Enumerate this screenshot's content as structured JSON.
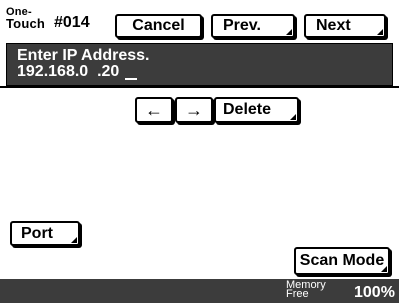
{
  "header": {
    "one_touch_line1": "One-",
    "one_touch_line2": "Touch",
    "entry_number": "#014",
    "cancel_label": "Cancel",
    "prev_label": "Prev.",
    "next_label": "Next"
  },
  "display": {
    "prompt": "Enter IP Address.",
    "ip_value": "192.168.0  .20"
  },
  "edit_buttons": {
    "left_arrow": "←",
    "right_arrow": "→",
    "delete_label": "Delete"
  },
  "port_label": "Port",
  "scan_mode_label": "Scan Mode",
  "status": {
    "memory_line1": "Memory",
    "memory_line2": "Free",
    "memory_value": "100%"
  },
  "colors": {
    "panel_background": "#3c3c3c",
    "text_light": "#ffffff"
  },
  "icons": [
    "left-arrow-icon",
    "right-arrow-icon"
  ]
}
